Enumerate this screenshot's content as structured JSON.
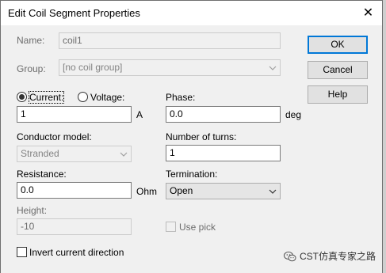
{
  "window": {
    "title": "Edit Coil Segment Properties",
    "close_glyph": "✕"
  },
  "name": {
    "label": "Name:",
    "value": "coil1"
  },
  "group": {
    "label": "Group:",
    "value": "[no coil group]"
  },
  "source": {
    "current_label": "Current:",
    "voltage_label": "Voltage:",
    "selected": "current",
    "value": "1",
    "unit": "A"
  },
  "phase": {
    "label": "Phase:",
    "value": "0.0",
    "unit": "deg"
  },
  "conductor": {
    "label": "Conductor model:",
    "value": "Stranded"
  },
  "turns": {
    "label": "Number of turns:",
    "value": "1"
  },
  "resistance": {
    "label": "Resistance:",
    "value": "0.0",
    "unit": "Ohm"
  },
  "termination": {
    "label": "Termination:",
    "value": "Open"
  },
  "height": {
    "label": "Height:",
    "value": "-10"
  },
  "use_pick": {
    "label": "Use pick",
    "checked": false
  },
  "invert": {
    "label": "Invert current direction",
    "checked": false
  },
  "buttons": {
    "ok": "OK",
    "cancel": "Cancel",
    "help": "Help"
  },
  "watermark": {
    "text": "CST仿真专家之路",
    "icon": "wechat-icon"
  }
}
